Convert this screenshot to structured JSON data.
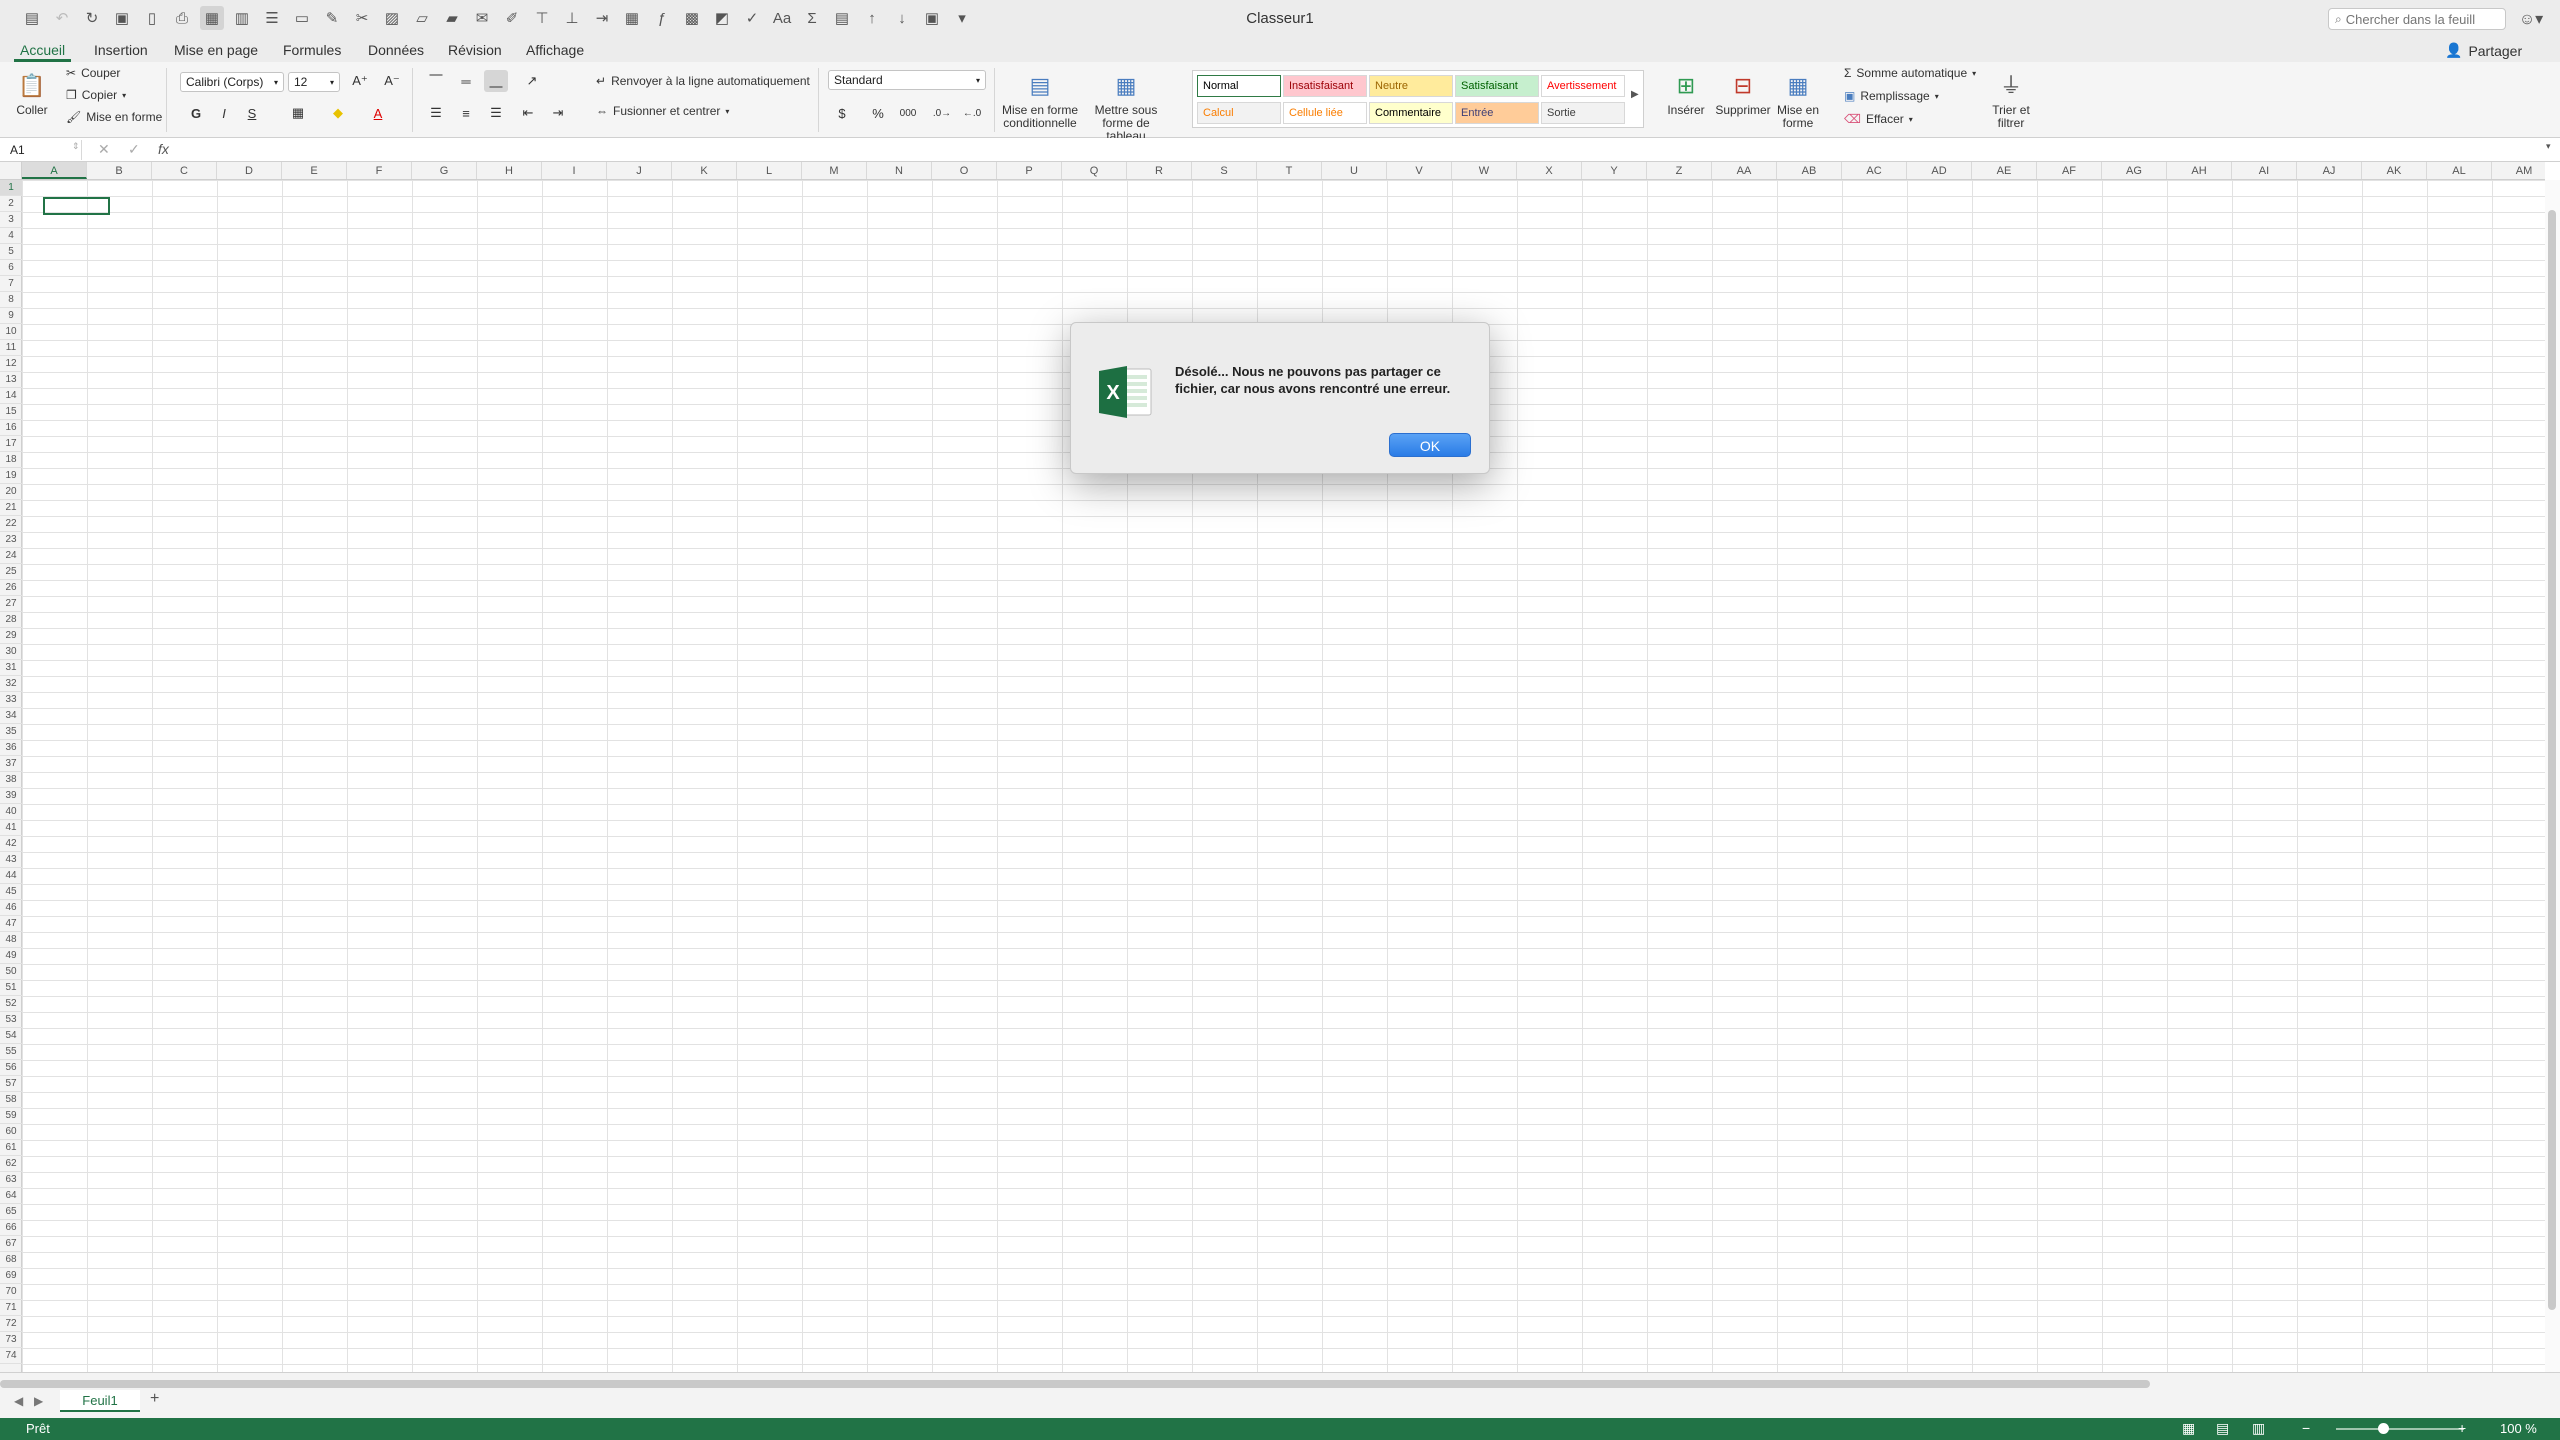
{
  "window": {
    "title": "Classeur1"
  },
  "search": {
    "placeholder": "Chercher dans la feuill"
  },
  "tabs": [
    {
      "label": "Accueil",
      "active": true
    },
    {
      "label": "Insertion"
    },
    {
      "label": "Mise en page"
    },
    {
      "label": "Formules"
    },
    {
      "label": "Données"
    },
    {
      "label": "Révision"
    },
    {
      "label": "Affichage"
    }
  ],
  "share": {
    "label": "Partager"
  },
  "ribbon": {
    "clipboard": {
      "paste": "Coller",
      "cut": "Couper",
      "copy": "Copier",
      "format_painter": "Mise en forme"
    },
    "font": {
      "name": "Calibri (Corps)",
      "size": "12",
      "bold": "G",
      "italic": "I",
      "underline": "S"
    },
    "alignment": {
      "wrap": "Renvoyer à la ligne automatiquement",
      "merge": "Fusionner et centrer"
    },
    "number": {
      "format": "Standard",
      "currency": "$",
      "percent": "%",
      "thousands": "000"
    },
    "conditional_format": "Mise en forme conditionnelle",
    "format_as_table": "Mettre sous forme de tableau",
    "styles": [
      {
        "label": "Normal",
        "color": "#000000",
        "bg": "#ffffff"
      },
      {
        "label": "Insatisfaisant",
        "color": "#9c0006",
        "bg": "#ffc7ce"
      },
      {
        "label": "Neutre",
        "color": "#9c6500",
        "bg": "#ffeb9c"
      },
      {
        "label": "Satisfaisant",
        "color": "#006100",
        "bg": "#c6efce"
      },
      {
        "label": "Avertissement",
        "color": "#ff0000",
        "bg": "#ffffff"
      },
      {
        "label": "Calcul",
        "color": "#fa7d00",
        "bg": "#f2f2f2"
      },
      {
        "label": "Cellule liée",
        "color": "#fa7d00",
        "bg": "#ffffff"
      },
      {
        "label": "Commentaire",
        "color": "#000000",
        "bg": "#ffffcc"
      },
      {
        "label": "Entrée",
        "color": "#3f3f76",
        "bg": "#ffcc99"
      },
      {
        "label": "Sortie",
        "color": "#3f3f3f",
        "bg": "#f2f2f2"
      }
    ],
    "cells": {
      "insert": "Insérer",
      "delete": "Supprimer",
      "format": "Mise en forme"
    },
    "editing": {
      "autosum": "Somme automatique",
      "fill": "Remplissage",
      "clear": "Effacer",
      "sort_filter": "Trier et filtrer"
    }
  },
  "formula_bar": {
    "name_box": "A1",
    "fx": "fx",
    "value": ""
  },
  "grid": {
    "columns": [
      "A",
      "B",
      "C",
      "D",
      "E",
      "F",
      "G",
      "H",
      "I",
      "J",
      "K",
      "L",
      "M",
      "N",
      "O",
      "P",
      "Q",
      "R",
      "S",
      "T",
      "U",
      "V",
      "W",
      "X",
      "Y",
      "Z",
      "AA",
      "AB",
      "AC",
      "AD",
      "AE",
      "AF",
      "AG",
      "AH",
      "AI",
      "AJ",
      "AK",
      "AL",
      "AM"
    ],
    "row_count": 74,
    "selected_cell": "A1"
  },
  "sheets": [
    {
      "label": "Feuil1",
      "active": true
    }
  ],
  "status": {
    "text": "Prêt",
    "zoom": "100 %"
  },
  "dialog": {
    "message": "Désolé... Nous ne pouvons pas partager ce fichier, car nous avons rencontré une erreur.",
    "ok_label": "OK"
  },
  "colors": {
    "accent": "#217346",
    "dialog_button": "#2a7ce6"
  }
}
